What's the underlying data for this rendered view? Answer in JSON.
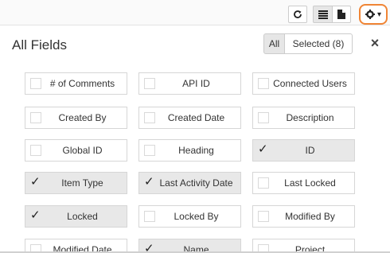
{
  "toolbar": {
    "refresh_icon": "refresh-icon",
    "list_view_icon": "list-view-icon",
    "document_view_icon": "document-icon",
    "settings_icon": "gear-icon",
    "settings_caret": "▾",
    "highlight_color": "#f08535"
  },
  "panel": {
    "title": "All Fields",
    "filter_all": "All",
    "filter_selected": "Selected (8)",
    "close": "×"
  },
  "fields": [
    {
      "label": "# of Comments",
      "checked": false
    },
    {
      "label": "API ID",
      "checked": false
    },
    {
      "label": "Connected Users",
      "checked": false
    },
    {
      "label": "Created By",
      "checked": false
    },
    {
      "label": "Created Date",
      "checked": false
    },
    {
      "label": "Description",
      "checked": false
    },
    {
      "label": "Global ID",
      "checked": false
    },
    {
      "label": "Heading",
      "checked": false
    },
    {
      "label": "ID",
      "checked": true
    },
    {
      "label": "Item Type",
      "checked": true
    },
    {
      "label": "Last Activity Date",
      "checked": true
    },
    {
      "label": "Last Locked",
      "checked": false
    },
    {
      "label": "Locked",
      "checked": true
    },
    {
      "label": "Locked By",
      "checked": false
    },
    {
      "label": "Modified By",
      "checked": false
    },
    {
      "label": "Modified Date",
      "checked": false
    },
    {
      "label": "Name",
      "checked": true
    },
    {
      "label": "Project",
      "checked": false
    }
  ]
}
